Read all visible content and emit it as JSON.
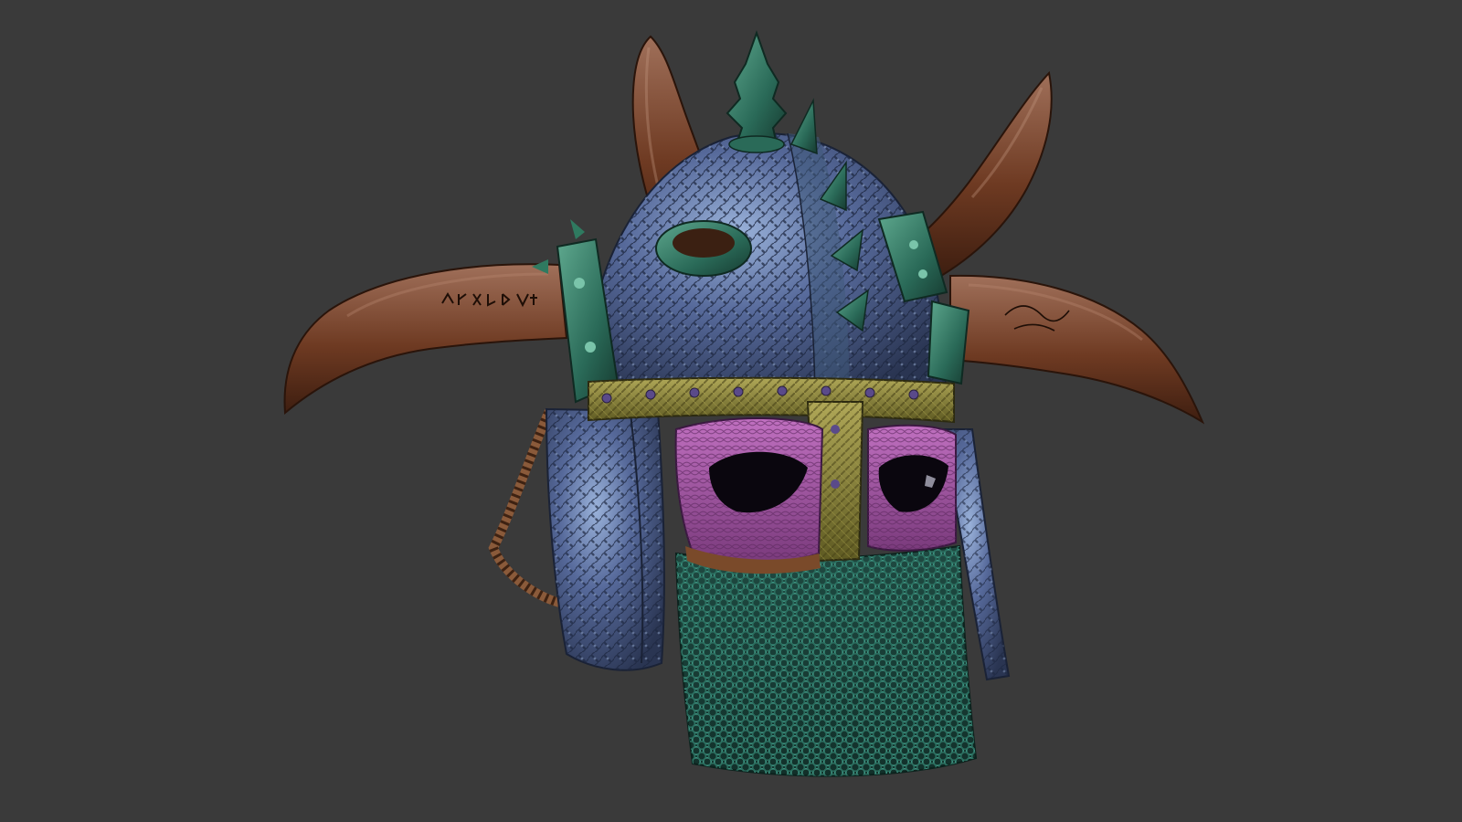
{
  "scene": {
    "background_color": "#3a3a3a",
    "subject": "horned-helmet",
    "colors": {
      "horn": "#6e3a22",
      "horn_highlight": "#a0705a",
      "dome_steel": "#4c5f86",
      "dome_highlight": "#98b0d8",
      "trim_green": "#2a6a58",
      "brow_band_gold": "#7f7a34",
      "eye_mask_magenta": "#9a4c9c",
      "chainmail_teal": "#2f7a6a",
      "stud_purple": "#5a4a8a",
      "rope": "#8a5a3a"
    }
  }
}
